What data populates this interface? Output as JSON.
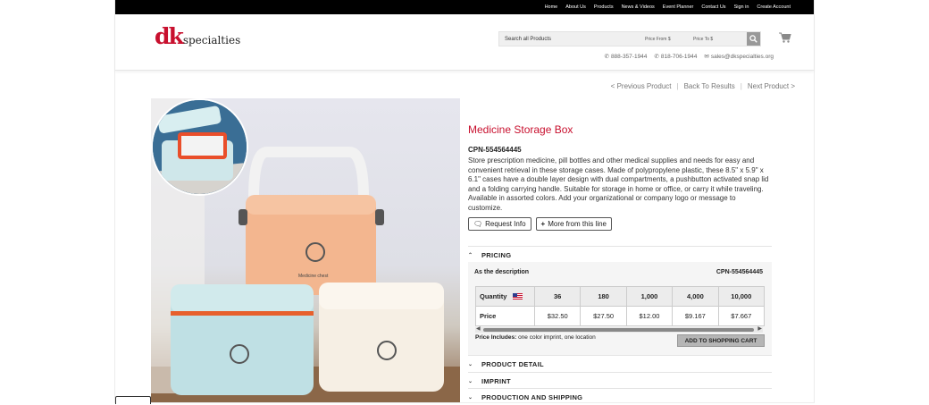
{
  "topnav": [
    "Home",
    "About Us",
    "Products",
    "News & Videos",
    "Event Planner",
    "Contact Us",
    "Sign in",
    "Create Account"
  ],
  "brand": {
    "mark": "dk",
    "name": "specialties",
    "color": "#c8102e"
  },
  "search": {
    "placeholder": "Search all Products",
    "price_from": "Price From $",
    "price_to": "Price To $"
  },
  "contacts": {
    "phone1": "888-357-1944",
    "phone2": "818-706-1944",
    "email": "sales@dkspecialties.org"
  },
  "pager": {
    "prev": "< Previous Product",
    "back": "Back To Results",
    "next": "Next Product >"
  },
  "product": {
    "title": "Medicine Storage Box",
    "sku": "CPN-554564445",
    "description": "Store prescription medicine, pill bottles and other medical supplies and needs for easy and convenient retrieval in these storage cases. Made of polypropylene plastic, these 8.5\" x 5.9\" x 6.1\" cases have a double layer design with dual compartments, a pushbutton activated snap lid and a folding carrying handle. Suitable for storage in home or office, or carry it while traveling. Available in assorted colors. Add your organizational or company logo or message to customize.",
    "request_label": "Request Info",
    "more_label": "More from this line",
    "box_label": "Medicine chest"
  },
  "sections": {
    "pricing": "PRICING",
    "detail": "PRODUCT DETAIL",
    "imprint": "IMPRINT",
    "shipping": "PRODUCTION AND SHIPPING"
  },
  "pricing": {
    "head": "As the description",
    "sku": "CPN-554564445",
    "qty_label": "Quantity",
    "price_label": "Price",
    "quantities": [
      "36",
      "180",
      "1,000",
      "4,000",
      "10,000"
    ],
    "prices": [
      "$32.50",
      "$27.50",
      "$12.00",
      "$9.167",
      "$7.667"
    ],
    "includes_label": "Price Includes:",
    "includes_text": "one color imprint, one location",
    "add_to_cart": "ADD TO SHOPPING CART"
  }
}
